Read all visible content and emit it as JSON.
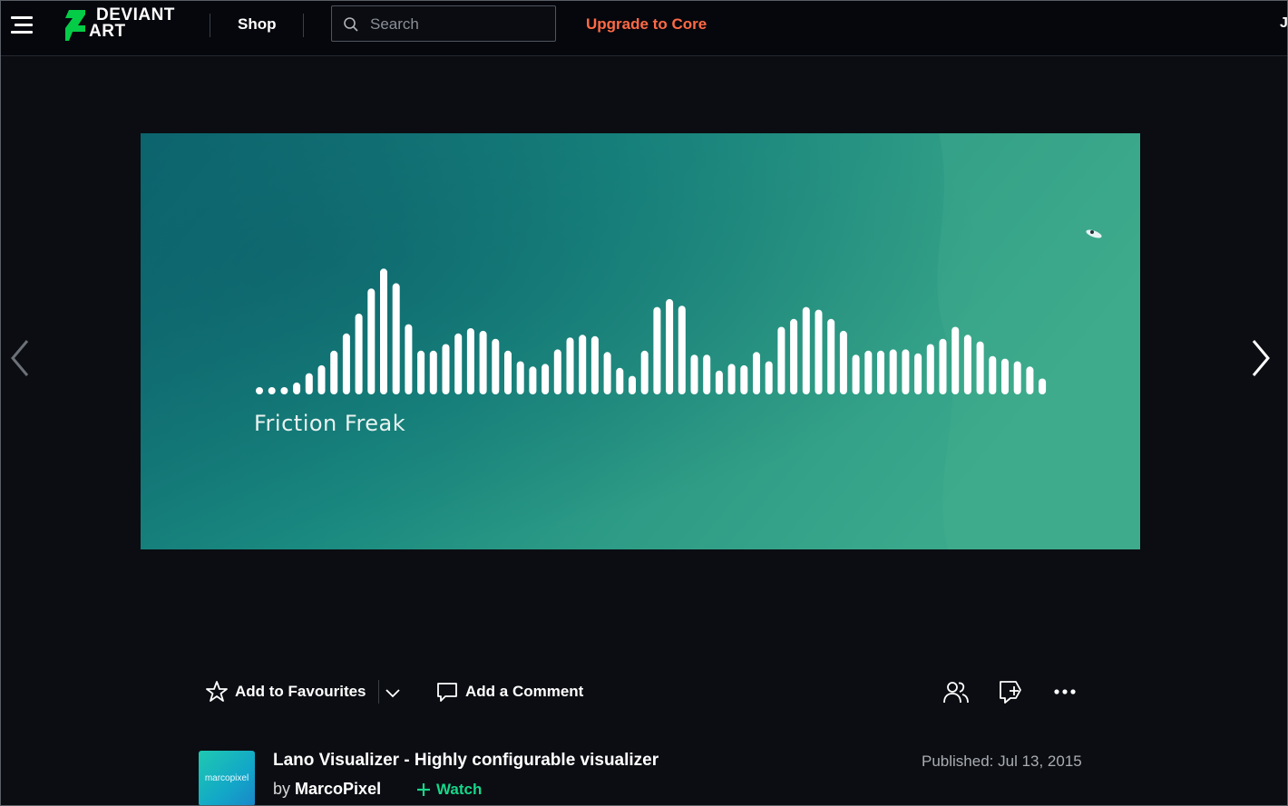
{
  "header": {
    "logo_line1": "DEVIANT",
    "logo_line2": "ART",
    "shop_label": "Shop",
    "search_placeholder": "Search",
    "upgrade_label": "Upgrade to Core",
    "user_initial": "J"
  },
  "artwork": {
    "caption": "Friction  Freak",
    "bar_levels": [
      0.02,
      0.02,
      0.05,
      0.09,
      0.16,
      0.22,
      0.33,
      0.46,
      0.61,
      0.8,
      0.95,
      0.84,
      0.53,
      0.33,
      0.33,
      0.38,
      0.46,
      0.5,
      0.48,
      0.42,
      0.33,
      0.25,
      0.21,
      0.23,
      0.34,
      0.43,
      0.45,
      0.44,
      0.32,
      0.2,
      0.14,
      0.33,
      0.66,
      0.72,
      0.67,
      0.3,
      0.3,
      0.18,
      0.23,
      0.22,
      0.32,
      0.25,
      0.51,
      0.57,
      0.66,
      0.64,
      0.57,
      0.48,
      0.3,
      0.33,
      0.33,
      0.34,
      0.34,
      0.31,
      0.38,
      0.42,
      0.51,
      0.45,
      0.4,
      0.29,
      0.27,
      0.25,
      0.21,
      0.12
    ],
    "colors": {
      "sea_dark": "#0f6f72",
      "sea_light": "#3fa589",
      "bars": "#ffffff"
    }
  },
  "actions": {
    "favourite_label": "Add to Favourites",
    "comment_label": "Add a Comment"
  },
  "deviation": {
    "title": "Lano Visualizer - Highly configurable visualizer",
    "by_prefix": "by",
    "author": "MarcoPixel",
    "watch_label": "Watch",
    "published": "Published: Jul 13, 2015",
    "avatar_text": "marcopixel"
  },
  "colors": {
    "accent_green": "#17d68a",
    "upgrade_orange": "#ff6a45",
    "background": "#0b0d12"
  }
}
